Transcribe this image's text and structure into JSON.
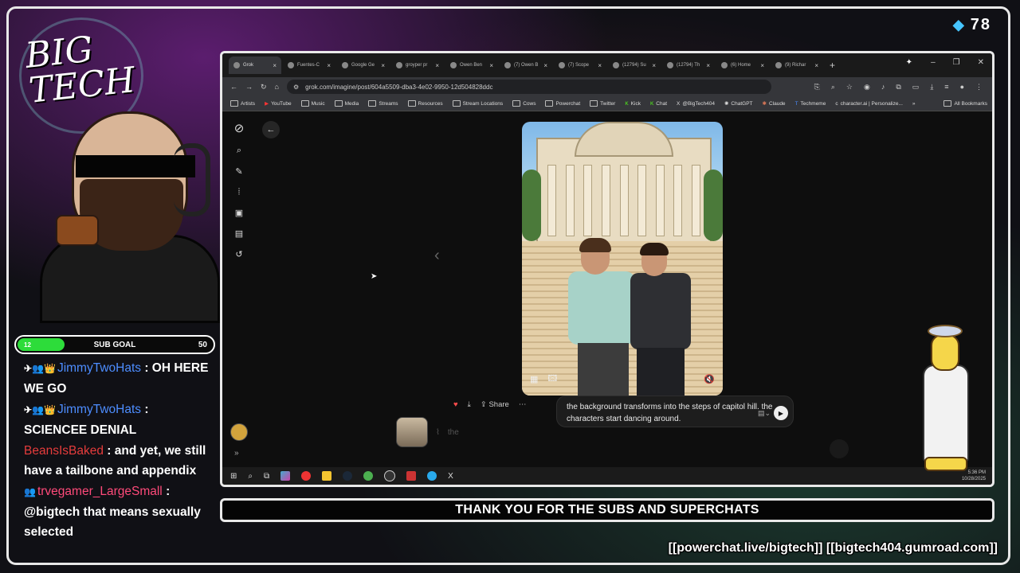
{
  "overlay": {
    "viewer_count": "78",
    "logo_text": "BIG TECH",
    "sub_goal": {
      "current": "12",
      "label": "SUB GOAL",
      "max": "50",
      "progress_fraction": 0.24
    },
    "banner": "THANK YOU FOR THE SUBS AND SUPERCHATS",
    "links": "[[powerchat.live/bigtech]] [[bigtech404.gumroad.com]]"
  },
  "chat": [
    {
      "badges": "✈👥👑",
      "user": "JimmyTwoHats",
      "text": ": OH HERE WE GO",
      "color": "#4d8dff"
    },
    {
      "badges": "✈👥👑",
      "user": "JimmyTwoHats",
      "text": ": SCIENCEE DENIAL",
      "color": "#4d8dff"
    },
    {
      "badges": "",
      "user": "BeansIsBaked",
      "text": ": and yet, we still have a tailbone and appendix",
      "color": "#e63c3c"
    },
    {
      "badges": "👥",
      "user": "trvegamer_LargeSmall",
      "text": ": @bigtech that means sexually selected",
      "color": "#ff4a7a"
    }
  ],
  "browser": {
    "tabs": [
      {
        "label": "Grok",
        "active": true
      },
      {
        "label": "Fuentes-C"
      },
      {
        "label": "Google Ge"
      },
      {
        "label": "groyper pr"
      },
      {
        "label": "Owen Ben"
      },
      {
        "label": "(7) Owen B"
      },
      {
        "label": "(7) Scope"
      },
      {
        "label": "(12794) Su"
      },
      {
        "label": "(12794) Th"
      },
      {
        "label": "(6) Home"
      },
      {
        "label": "(9) Richar"
      }
    ],
    "url": "grok.com/imagine/post/604a5509-dba3-4e02-9950-12d504828ddc",
    "bookmarks": [
      "Artists",
      "YouTube",
      "Music",
      "Media",
      "Streams",
      "Resources",
      "Stream Locations",
      "Cows",
      "Powerchat",
      "Twitter",
      "Kick",
      "Chat",
      "@BigTech404",
      "ChatGPT",
      "Claude",
      "Techmeme",
      "character.ai | Personalize..."
    ],
    "all_bookmarks": "All Bookmarks",
    "share_label": "Share",
    "prompt_text": "the background transforms into the steps of capitol hill. the characters start dancing around.",
    "input_placeholder": "the",
    "clock_time": "5:36 PM",
    "clock_date": "10/28/2025"
  },
  "icons": {
    "grok_logo": "grok-logo-icon",
    "search": "search-icon",
    "compose": "compose-icon",
    "voice": "voice-icon",
    "imagine": "imagine-icon",
    "projects": "projects-icon",
    "history": "history-icon"
  }
}
